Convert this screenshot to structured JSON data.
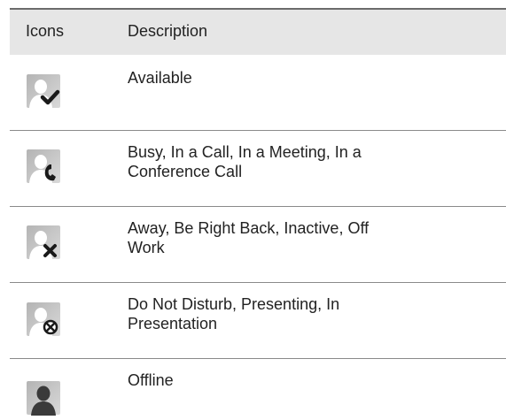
{
  "table": {
    "columns": [
      "Icons",
      "Description"
    ],
    "rows": [
      {
        "icon": "available-status-icon",
        "description_lines": [
          "Available"
        ]
      },
      {
        "icon": "busy-status-icon",
        "description_lines": [
          "Busy, In a Call, In a Meeting, In a",
          "Conference Call"
        ]
      },
      {
        "icon": "away-status-icon",
        "description_lines": [
          "Away, Be Right Back, Inactive, Off",
          "Work"
        ]
      },
      {
        "icon": "do-not-disturb-status-icon",
        "description_lines": [
          "Do Not Disturb, Presenting, In",
          "Presentation"
        ]
      },
      {
        "icon": "offline-status-icon",
        "description_lines": [
          "Offline"
        ]
      }
    ]
  },
  "colors": {
    "header_bg": "#e6e6e6",
    "header_rule": "#6b6b6b",
    "row_rule": "#8a8a8a",
    "icon_tile": "#c8c8c8",
    "icon_silhouette": "#ffffff",
    "icon_badge": "#1a1a1a",
    "offline_silhouette": "#3a3a3a"
  }
}
